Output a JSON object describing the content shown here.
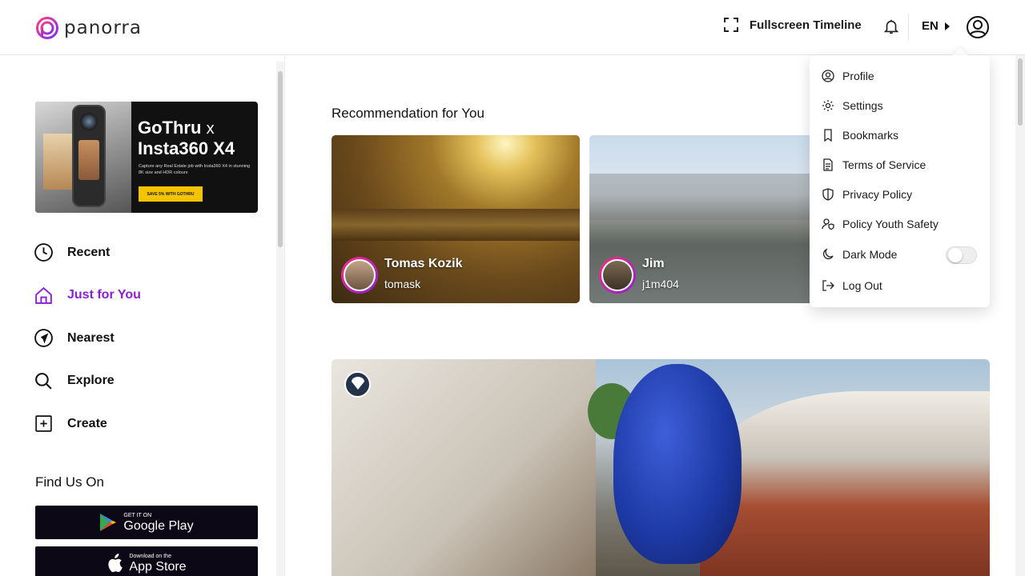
{
  "app": {
    "logo_text": "panorra",
    "brand_color": "#8a1fd6"
  },
  "header": {
    "fullscreen_label": "Fullscreen Timeline",
    "language": "EN"
  },
  "sidebar": {
    "promo": {
      "title_brand": "GoThru",
      "title_x": "x",
      "title_line2": "Insta360 X4",
      "description": "Capture any Real Estate job with Insta360 X4 in stunning 8K size and HDR colours",
      "cta": "SAVE 5% WITH GOTHRU"
    },
    "nav": [
      {
        "label": "Recent",
        "icon": "clock-icon"
      },
      {
        "label": "Just for You",
        "icon": "home-icon",
        "active": true
      },
      {
        "label": "Nearest",
        "icon": "navigation-icon"
      },
      {
        "label": "Explore",
        "icon": "search-icon"
      },
      {
        "label": "Create",
        "icon": "plus-square-icon"
      }
    ],
    "find_us_title": "Find Us On",
    "stores": {
      "google_small": "GET IT ON",
      "google_big": "Google Play",
      "apple_small": "Download on the",
      "apple_big": "App Store"
    }
  },
  "main": {
    "section_title": "Recommendation for You",
    "cards": [
      {
        "name": "Tomas Kozik",
        "handle": "tomask"
      },
      {
        "name": "Jim",
        "handle": "j1m404"
      }
    ]
  },
  "menu": {
    "items": [
      {
        "label": "Profile",
        "icon": "user-circle-icon"
      },
      {
        "label": "Settings",
        "icon": "gear-icon"
      },
      {
        "label": "Bookmarks",
        "icon": "bookmark-icon"
      },
      {
        "label": "Terms of Service",
        "icon": "document-icon"
      },
      {
        "label": "Privacy Policy",
        "icon": "shield-icon"
      },
      {
        "label": "Policy Youth Safety",
        "icon": "user-shield-icon"
      },
      {
        "label": "Dark Mode",
        "icon": "moon-icon"
      },
      {
        "label": "Log Out",
        "icon": "logout-icon"
      }
    ],
    "dark_mode_on": false
  }
}
